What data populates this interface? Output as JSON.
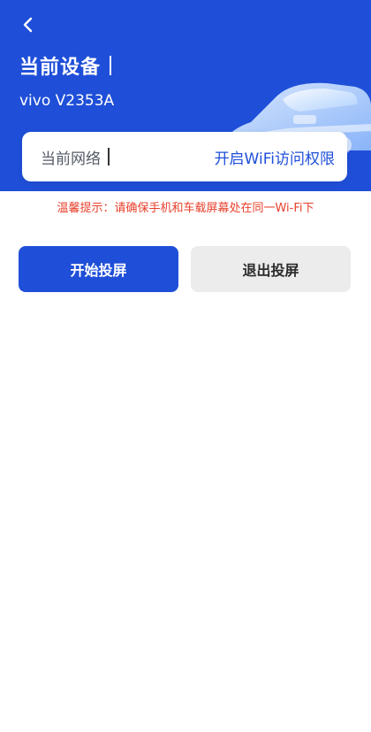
{
  "header": {
    "back_icon": "chevron-left-icon",
    "section_title": "当前设备",
    "device_name": "vivo V2353A",
    "colors": {
      "primary": "#1f4fd8",
      "header_bg": "#1f4fd8",
      "car_tint": "#cfe3ff"
    }
  },
  "network": {
    "label": "当前网络",
    "action_link": "开启WiFi访问权限"
  },
  "tip": {
    "text": "温馨提示：请确保手机和车载屏幕处在同一Wi-Fi下",
    "color": "#e8402c"
  },
  "actions": {
    "start_label": "开始投屏",
    "exit_label": "退出投屏"
  }
}
